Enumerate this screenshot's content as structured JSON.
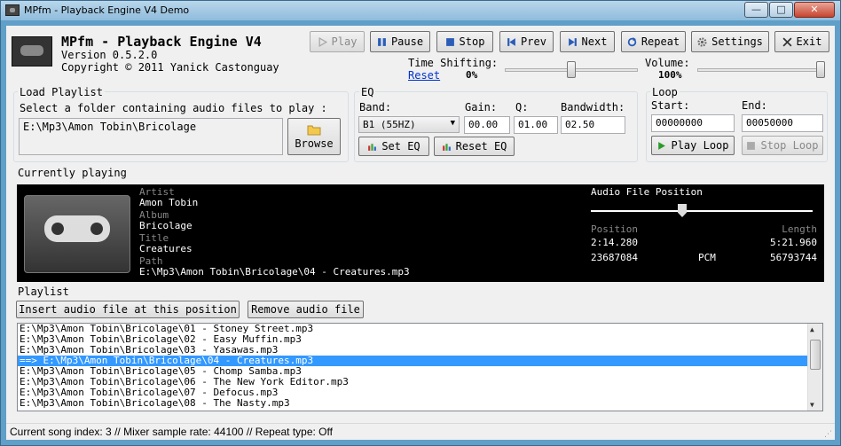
{
  "window": {
    "title": "MPfm - Playback Engine V4 Demo",
    "minimize": "—",
    "maximize": "□",
    "close": "✕"
  },
  "header": {
    "app_name": "MPfm - Playback Engine V4",
    "version": "Version 0.5.2.0",
    "copyright": "Copyright © 2011 Yanick Castonguay"
  },
  "toolbar": {
    "play": "Play",
    "pause": "Pause",
    "stop": "Stop",
    "prev": "Prev",
    "next": "Next",
    "repeat": "Repeat",
    "settings": "Settings",
    "exit": "Exit"
  },
  "time_shifting": {
    "label": "Time Shifting:",
    "reset": "Reset",
    "value": "0%",
    "level": 0.5
  },
  "volume": {
    "label": "Volume:",
    "value": "100%",
    "level": 1.0
  },
  "load_playlist": {
    "title": "Load Playlist",
    "instruction": "Select a folder containing audio files to play :",
    "folder": "E:\\Mp3\\Amon Tobin\\Bricolage",
    "browse": "Browse"
  },
  "eq": {
    "title": "EQ",
    "band_label": "Band:",
    "band_value": "B1 (55HZ)",
    "gain_label": "Gain:",
    "gain_value": "00.00",
    "q_label": "Q:",
    "q_value": "01.00",
    "bandwidth_label": "Bandwidth:",
    "bandwidth_value": "02.50",
    "set_eq": "Set EQ",
    "reset_eq": "Reset EQ"
  },
  "loop": {
    "title": "Loop",
    "start_label": "Start:",
    "start_value": "00000000",
    "end_label": "End:",
    "end_value": "00050000",
    "play_loop": "Play Loop",
    "stop_loop": "Stop Loop"
  },
  "now_playing": {
    "title": "Currently playing",
    "artist_label": "Artist",
    "artist": "Amon Tobin",
    "album_label": "Album",
    "album": "Bricolage",
    "title_label": "Title",
    "track_title": "Creatures",
    "path_label": "Path",
    "path": "E:\\Mp3\\Amon Tobin\\Bricolage\\04 - Creatures.mp3",
    "file_position_label": "Audio File Position",
    "file_position_level": 0.41,
    "position_label": "Position",
    "position_time": "2:14.280",
    "position_bytes": "23687084",
    "length_label": "Length",
    "length_time": "5:21.960",
    "length_bytes": "56793744",
    "format": "PCM"
  },
  "playlist": {
    "title": "Playlist",
    "insert_button": "Insert audio file at this position",
    "remove_button": "Remove audio file",
    "items": [
      "E:\\Mp3\\Amon Tobin\\Bricolage\\01 - Stoney Street.mp3",
      "E:\\Mp3\\Amon Tobin\\Bricolage\\02 - Easy Muffin.mp3",
      "E:\\Mp3\\Amon Tobin\\Bricolage\\03 - Yasawas.mp3",
      "==> E:\\Mp3\\Amon Tobin\\Bricolage\\04 - Creatures.mp3",
      "E:\\Mp3\\Amon Tobin\\Bricolage\\05 - Chomp Samba.mp3",
      "E:\\Mp3\\Amon Tobin\\Bricolage\\06 - The New York Editor.mp3",
      "E:\\Mp3\\Amon Tobin\\Bricolage\\07 - Defocus.mp3",
      "E:\\Mp3\\Amon Tobin\\Bricolage\\08 - The Nasty.mp3"
    ],
    "selected_index": 3
  },
  "status": {
    "text": "Current song index: 3 // Mixer sample rate: 44100 // Repeat type: Off"
  },
  "colors": {
    "selection": "#3399ff",
    "player_bg": "#000000",
    "link": "#0033cc"
  }
}
